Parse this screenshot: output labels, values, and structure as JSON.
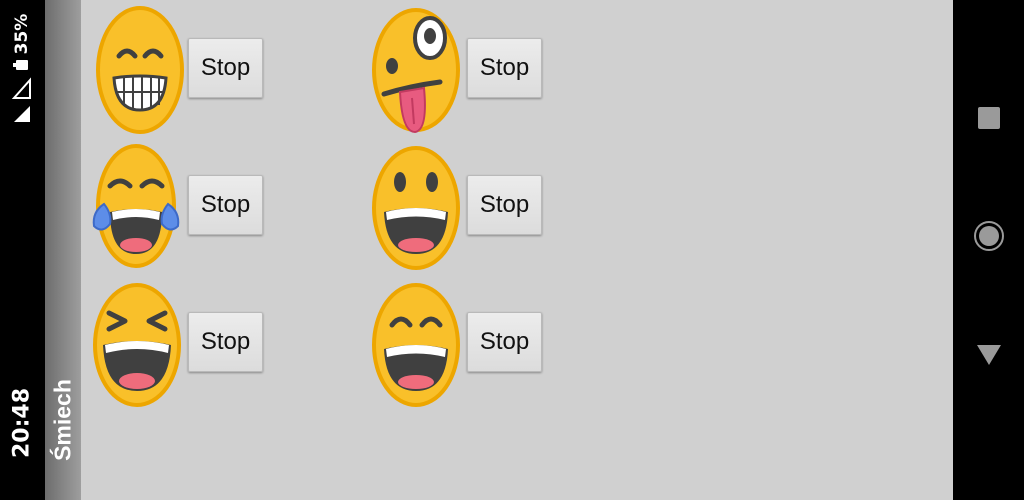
{
  "status_bar": {
    "time": "20:48",
    "battery_percent": "35%",
    "icons": [
      "signal-icon",
      "wifi-icon",
      "battery-icon"
    ]
  },
  "app_bar": {
    "title": "Śmiech"
  },
  "grid": [
    {
      "emoji": "grinning-squinting-face-icon",
      "button_label": "Stop"
    },
    {
      "emoji": "zany-face-icon",
      "button_label": "Stop"
    },
    {
      "emoji": "tears-of-joy-face-icon",
      "button_label": "Stop"
    },
    {
      "emoji": "grinning-big-eyes-face-icon",
      "button_label": "Stop"
    },
    {
      "emoji": "laughing-squinting-face-icon",
      "button_label": "Stop"
    },
    {
      "emoji": "grinning-smiling-eyes-face-icon",
      "button_label": "Stop"
    }
  ],
  "nav_bar": {
    "buttons": [
      "recents-button",
      "home-button",
      "back-button"
    ]
  },
  "colors": {
    "emoji_face": "#f9c02a",
    "emoji_rim": "#eda600",
    "content_bg": "#d0d0d0",
    "app_bar_bg": "#8a8a8a"
  }
}
